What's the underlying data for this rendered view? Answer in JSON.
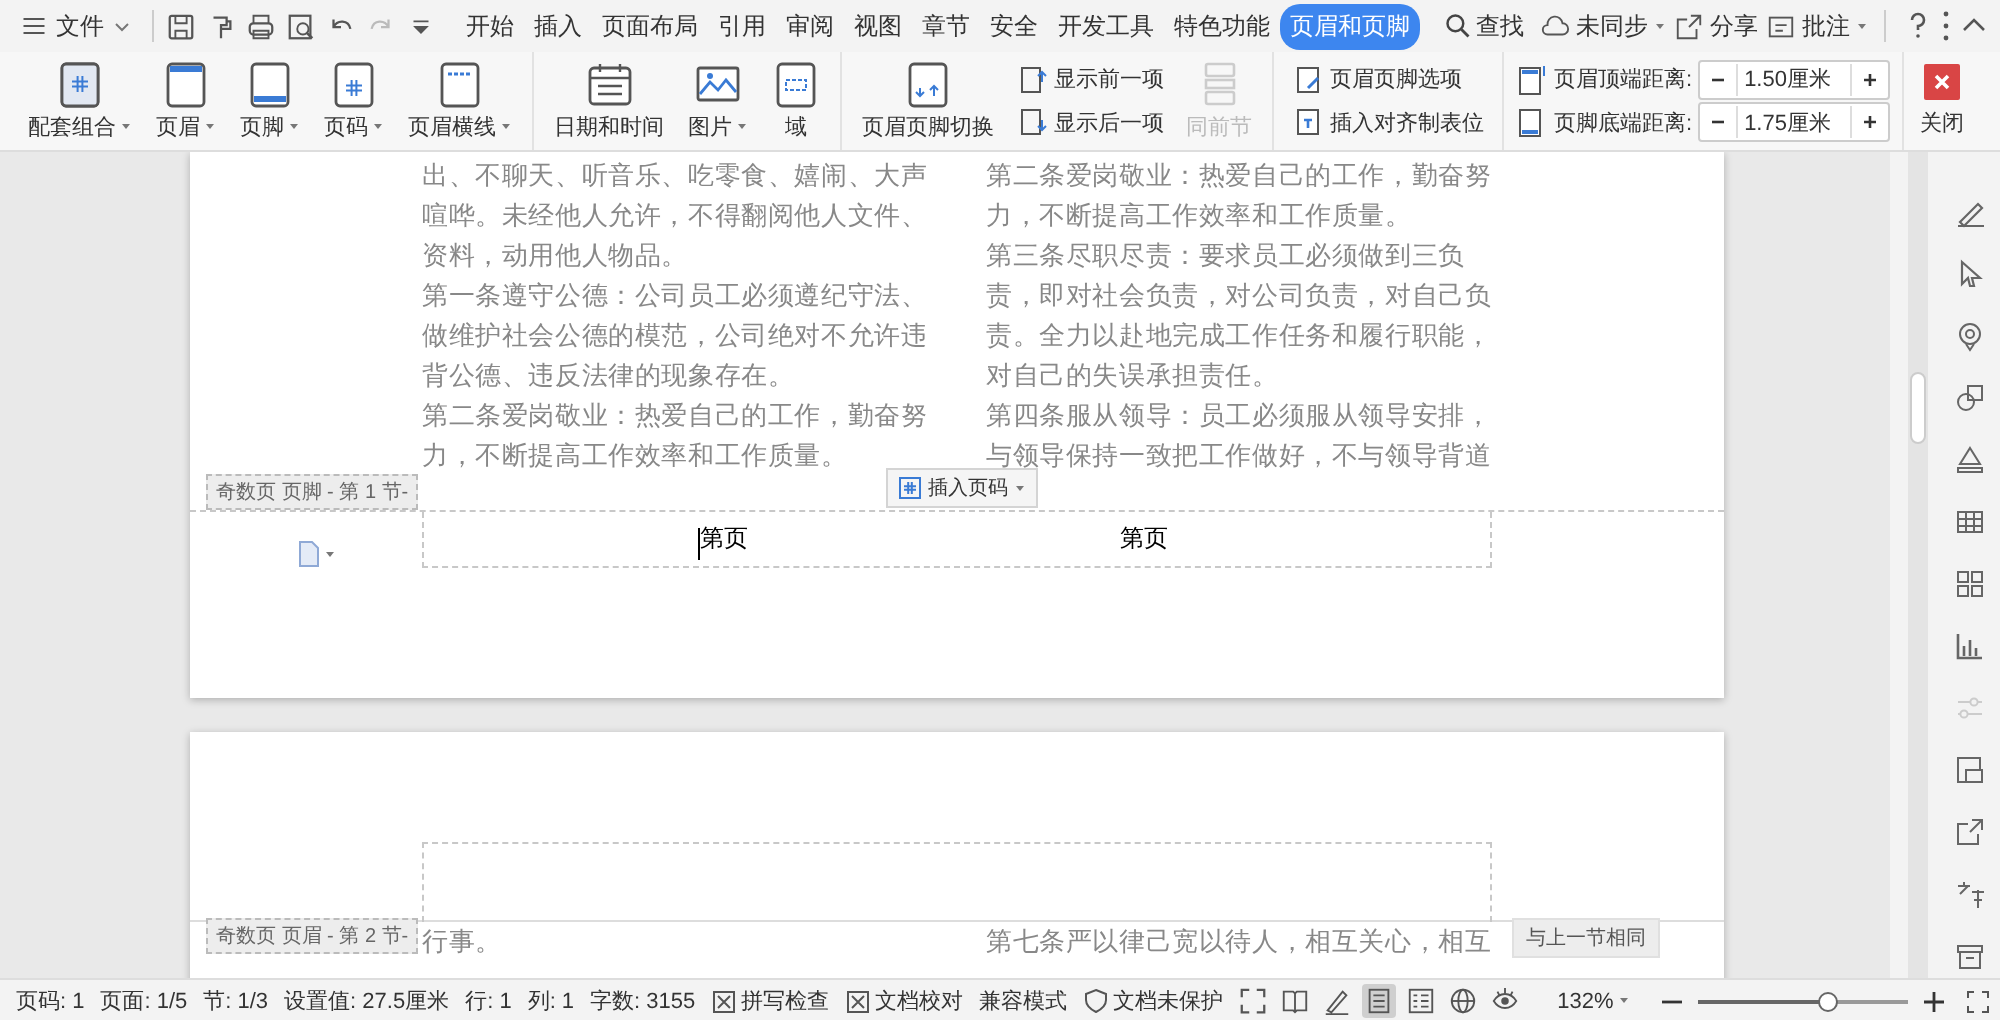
{
  "menu": {
    "label": "文件"
  },
  "quick_tools": [
    {
      "disabled": false
    },
    {
      "disabled": false
    },
    {
      "disabled": false
    },
    {
      "disabled": false
    },
    {
      "disabled": false
    },
    {
      "disabled": true
    },
    {
      "disabled": false
    }
  ],
  "tabs": [
    {
      "label": "开始",
      "selected": false
    },
    {
      "label": "插入",
      "selected": false
    },
    {
      "label": "页面布局",
      "selected": false
    },
    {
      "label": "引用",
      "selected": false
    },
    {
      "label": "审阅",
      "selected": false
    },
    {
      "label": "视图",
      "selected": false
    },
    {
      "label": "章节",
      "selected": false
    },
    {
      "label": "安全",
      "selected": false
    },
    {
      "label": "开发工具",
      "selected": false
    },
    {
      "label": "特色功能",
      "selected": false
    },
    {
      "label": "页眉和页脚",
      "selected": true
    }
  ],
  "search": {
    "label": "查找"
  },
  "top_right": [
    {
      "label": "未同步",
      "has_menu": true
    },
    {
      "label": "分享",
      "has_menu": false
    },
    {
      "label": "批注",
      "has_menu": true
    }
  ],
  "ribbon": {
    "insert_group": [
      {
        "label": "配套组合",
        "has_menu": true
      },
      {
        "label": "页眉",
        "has_menu": true
      },
      {
        "label": "页脚",
        "has_menu": true
      },
      {
        "label": "页码",
        "has_menu": true
      },
      {
        "label": "页眉横线",
        "has_menu": true
      }
    ],
    "field_group": [
      {
        "label": "日期和时间",
        "has_menu": false
      },
      {
        "label": "图片",
        "has_menu": true
      },
      {
        "label": "域",
        "has_menu": false
      }
    ],
    "switch": {
      "label": "页眉页脚切换"
    },
    "navigation": [
      {
        "label": "显示前一项",
        "disabled": false
      },
      {
        "label": "显示后一项",
        "disabled": false
      }
    ],
    "link_previous": {
      "label": "同前节",
      "disabled": true
    },
    "options": [
      {
        "label": "页眉页脚选项"
      },
      {
        "label": "插入对齐制表位"
      }
    ],
    "distances": [
      {
        "label": "页眉顶端距离:",
        "value": "1.50厘米"
      },
      {
        "label": "页脚底端距离:",
        "value": "1.75厘米"
      }
    ],
    "close": {
      "label": "关闭"
    }
  },
  "page_1": {
    "columns": [
      [
        {
          "lines": [
            "出、不聊天、听音乐、吃零食、嬉闹、大声",
            "喧哗。未经他人允许，不得翻阅他人文件、",
            "资料，动用他人物品。"
          ]
        },
        {
          "lines": [
            "第一条遵守公德：公司员工必须遵纪守法、",
            "做维护社会公德的模范，公司绝对不允许违",
            "背公德、违反法律的现象存在。"
          ]
        },
        {
          "lines": [
            "第二条爱岗敬业：热爱自己的工作，勤奋努",
            "力，不断提高工作效率和工作质量。"
          ]
        }
      ],
      [
        {
          "lines": [
            "第二条爱岗敬业：热爱自己的工作，勤奋努",
            "力，不断提高工作效率和工作质量。"
          ]
        },
        {
          "lines": [
            "第三条尽职尽责：要求员工必须做到三负",
            "责，即对社会负责，对公司负责，对自己负",
            "责。全力以赴地完成工作任务和履行职能，",
            "对自己的失误承担责任。"
          ]
        },
        {
          "lines": [
            "第四条服从领导：员工必须服从领导安排，",
            "与领导保持一致把工作做好，不与领导背道"
          ]
        }
      ]
    ],
    "footer_label": "奇数页 页脚 - 第 1 节-",
    "insert_page_number": "插入页码",
    "footer_fields": [
      "第页",
      "第页"
    ]
  },
  "page_2": {
    "header_label": "奇数页 页眉 - 第 2 节-",
    "same_as_previous": "与上一节相同",
    "columns": [
      [
        {
          "lines": [
            "行事。"
          ]
        }
      ],
      [
        {
          "lines": [
            "第七条严以律己宽以待人，相互关心，相互"
          ]
        }
      ]
    ]
  },
  "status_bar": {
    "items": [
      {
        "label": "页码: 1",
        "kind": "text"
      },
      {
        "label": "页面: 1/5",
        "kind": "text"
      },
      {
        "label": "节: 1/3",
        "kind": "text"
      },
      {
        "label": "设置值: 27.5厘米",
        "kind": "text"
      },
      {
        "label": "行: 1",
        "kind": "text"
      },
      {
        "label": "列: 1",
        "kind": "text"
      },
      {
        "label": "字数: 3155",
        "kind": "text"
      },
      {
        "label": "拼写检查",
        "kind": "check"
      },
      {
        "label": "文档校对",
        "kind": "check"
      },
      {
        "label": "兼容模式",
        "kind": "text"
      },
      {
        "label": "文档未保护",
        "kind": "shield"
      }
    ],
    "views": [
      {
        "selected": false
      },
      {
        "selected": false
      },
      {
        "selected": false
      },
      {
        "selected": true
      },
      {
        "selected": false
      },
      {
        "selected": false
      },
      {
        "selected": false
      }
    ],
    "zoom": {
      "label": "132%",
      "level": 0.62
    }
  }
}
